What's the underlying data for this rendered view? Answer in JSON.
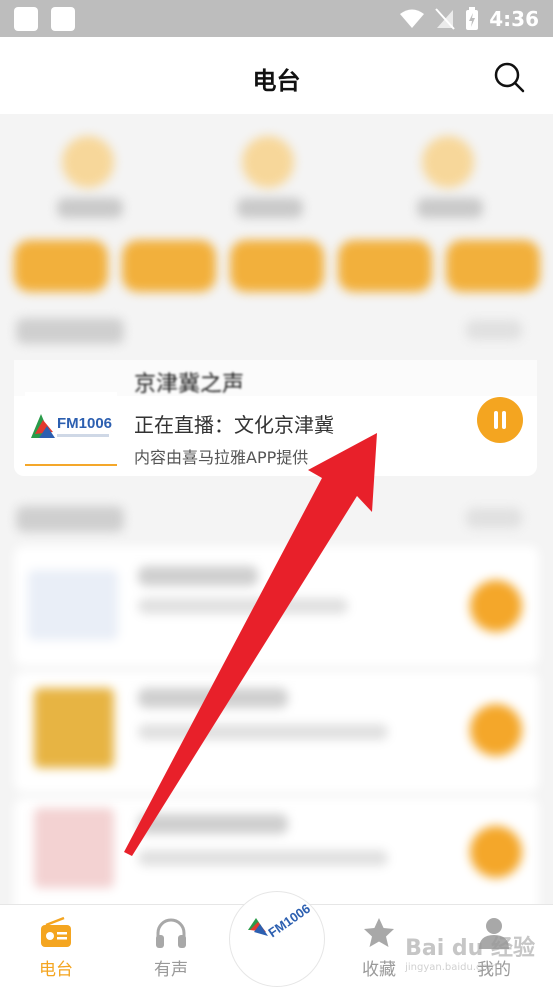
{
  "status_bar": {
    "time": "4:36"
  },
  "header": {
    "title": "电台"
  },
  "live_card": {
    "station_title": "京津冀之声",
    "status": "正在直播：文化京津冀",
    "source_note": "内容由喜马拉雅APP提供",
    "logo_text": "FM1006"
  },
  "bottom_nav": {
    "items": [
      {
        "label": "电台",
        "icon": "radio-icon"
      },
      {
        "label": "有声",
        "icon": "headphones-icon"
      },
      {
        "label": "收藏",
        "icon": "star-icon"
      },
      {
        "label": "我的",
        "icon": "user-icon"
      }
    ],
    "active": "电台",
    "center_logo": "FM1006"
  },
  "watermark": {
    "text": "Bai du 经验",
    "sub": "jingyan.baidu.com"
  },
  "colors": {
    "accent": "#f4a520",
    "arrow": "#e8202a"
  }
}
